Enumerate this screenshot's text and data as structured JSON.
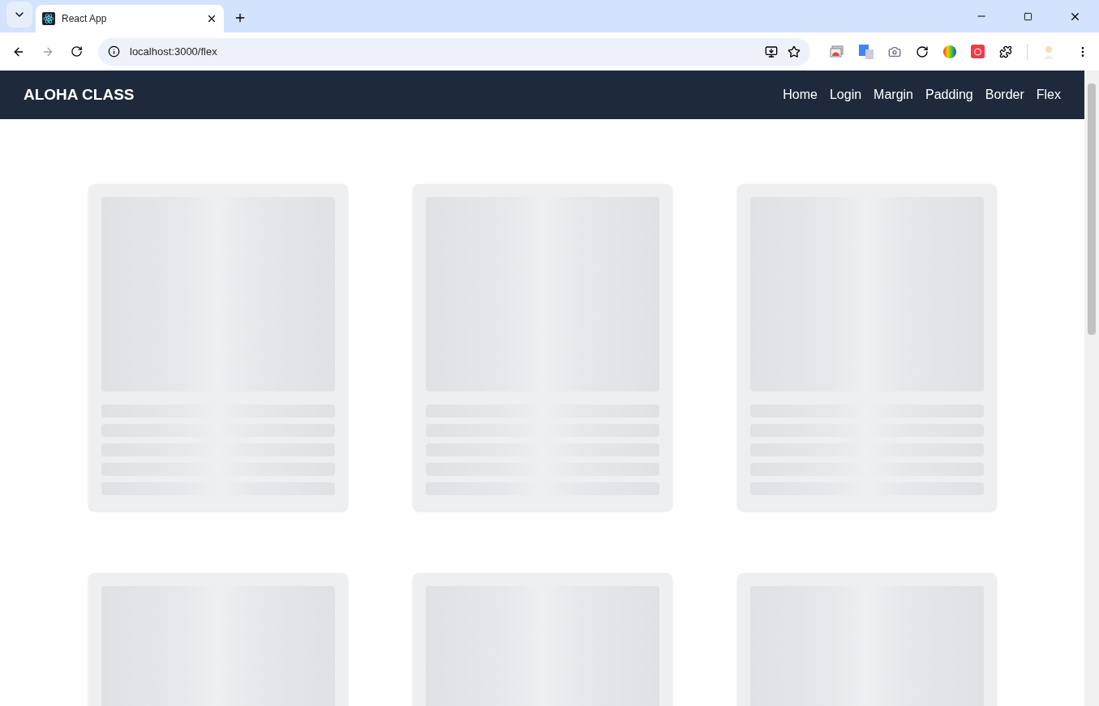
{
  "browser": {
    "tab_title": "React App",
    "url": "localhost:3000/flex"
  },
  "navbar": {
    "brand": "ALOHA CLASS",
    "links": [
      {
        "label": "Home"
      },
      {
        "label": "Login"
      },
      {
        "label": "Margin"
      },
      {
        "label": "Padding"
      },
      {
        "label": "Border"
      },
      {
        "label": "Flex"
      }
    ]
  },
  "cards": [
    {
      "kind": "skeleton"
    },
    {
      "kind": "skeleton"
    },
    {
      "kind": "skeleton"
    },
    {
      "kind": "skeleton_top"
    },
    {
      "kind": "skeleton_top"
    },
    {
      "kind": "skeleton_top"
    }
  ]
}
